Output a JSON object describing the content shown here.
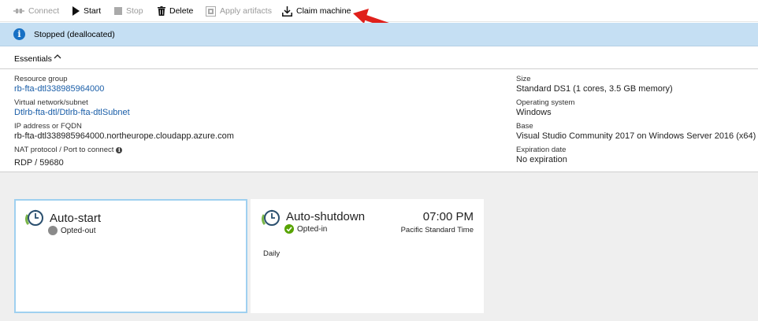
{
  "toolbar": {
    "connect_label": "Connect",
    "start_label": "Start",
    "stop_label": "Stop",
    "delete_label": "Delete",
    "apply_artifacts_label": "Apply artifacts",
    "claim_machine_label": "Claim machine"
  },
  "status": {
    "text": "Stopped (deallocated)"
  },
  "essentials": {
    "label": "Essentials"
  },
  "properties": {
    "resource_group": {
      "label": "Resource group",
      "value": "rb-fta-dtl338985964000"
    },
    "virtual_network": {
      "label": "Virtual network/subnet",
      "value": "Dtlrb-fta-dtl/Dtlrb-fta-dtlSubnet"
    },
    "ip_address": {
      "label": "IP address or FQDN",
      "value": "rb-fta-dtl338985964000.northeurope.cloudapp.azure.com"
    },
    "nat_protocol": {
      "label": "NAT protocol / Port to connect",
      "value": "RDP / 59680"
    },
    "size": {
      "label": "Size",
      "value": "Standard DS1 (1 cores, 3.5 GB memory)"
    },
    "operating_system": {
      "label": "Operating system",
      "value": "Windows"
    },
    "base": {
      "label": "Base",
      "value": "Visual Studio Community 2017 on Windows Server 2016 (x64)"
    },
    "expiration": {
      "label": "Expiration date",
      "value": "No expiration"
    }
  },
  "tiles": {
    "auto_start": {
      "title": "Auto-start",
      "status": "Opted-out"
    },
    "auto_shutdown": {
      "title": "Auto-shutdown",
      "status": "Opted-in",
      "time": "07:00 PM",
      "timezone": "Pacific Standard Time",
      "schedule": "Daily"
    }
  },
  "colors": {
    "status_bar": "#c5dff3",
    "info_icon": "#1770c4",
    "link": "#1a5ea8",
    "opted_in": "#57a300",
    "opted_out": "#8a8a8a",
    "annotation_arrow": "#e0201b"
  },
  "icons": {
    "connect": "connect-icon",
    "start": "play-icon",
    "stop": "stop-icon",
    "delete": "trash-icon",
    "apply_artifacts": "artifacts-icon",
    "claim_machine": "download-icon",
    "status": "info-icon",
    "essentials": "chevron-up-icon",
    "tile": "clock-icon"
  }
}
